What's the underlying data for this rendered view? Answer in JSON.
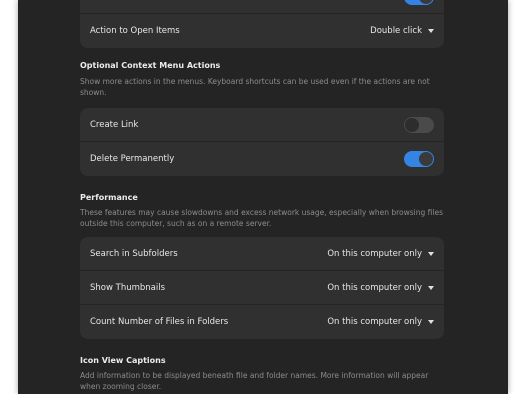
{
  "behavior": {
    "action_label": "Action to Open Items",
    "action_value": "Double click"
  },
  "context_menu": {
    "title": "Optional Context Menu Actions",
    "description": "Show more actions in the menus. Keyboard shortcuts can be used even if the actions are not shown.",
    "create_link_label": "Create Link",
    "create_link_enabled": false,
    "delete_permanently_label": "Delete Permanently",
    "delete_permanently_enabled": true
  },
  "performance": {
    "title": "Performance",
    "description": "These features may cause slowdowns and excess network usage, especially when browsing files outside this computer, such as on a remote server.",
    "rows": [
      {
        "label": "Search in Subfolders",
        "value": "On this computer only"
      },
      {
        "label": "Show Thumbnails",
        "value": "On this computer only"
      },
      {
        "label": "Count Number of Files in Folders",
        "value": "On this computer only"
      }
    ]
  },
  "icon_view": {
    "title": "Icon View Captions",
    "description": "Add information to be displayed beneath file and folder names. More information will appear when zooming closer."
  },
  "colors": {
    "accent": "#3584e4",
    "window_bg": "#242424",
    "card_bg": "#303030"
  }
}
